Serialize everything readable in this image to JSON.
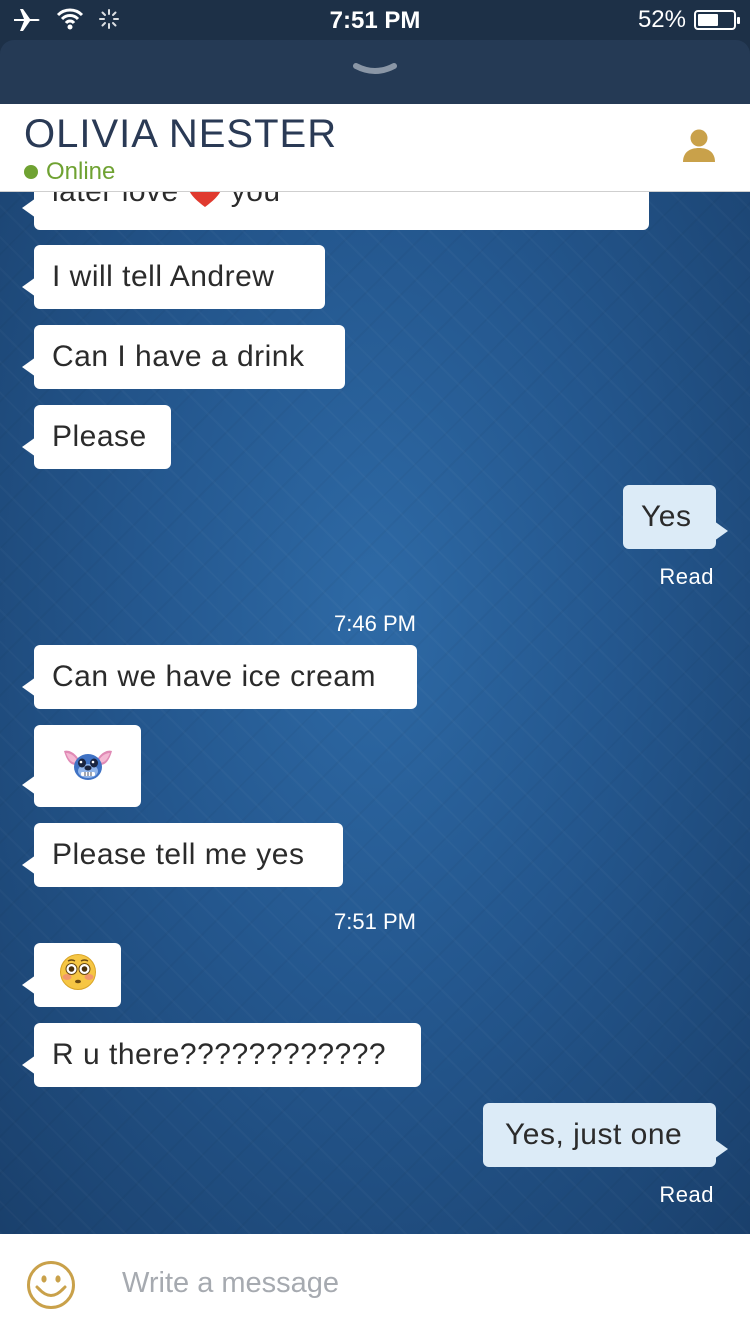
{
  "status_bar": {
    "time": "7:51 PM",
    "battery_percent": "52%",
    "battery_level": 0.52,
    "icons": [
      "airplane-icon",
      "wifi-icon",
      "loading-icon"
    ]
  },
  "header": {
    "contact_name": "OLIVIA NESTER",
    "presence": "Online",
    "presence_color": "#6fa232",
    "profile_icon_color": "#c9a14a"
  },
  "messages": {
    "m0_before": "later love",
    "m0_after": "you",
    "m1": "I will tell Andrew",
    "m2": "Can I have a drink",
    "m3": "Please",
    "m4": "Yes",
    "m4_status": "Read",
    "time_1": "7:46 PM",
    "m5": "Can we have ice cream",
    "m7": "Please tell me yes",
    "time_2": "7:51 PM",
    "m9": "R u there????????????",
    "m10": "Yes, just one",
    "m10_status": "Read"
  },
  "composer": {
    "placeholder": "Write a message"
  },
  "colors": {
    "incoming_bubble": "#ffffff",
    "outgoing_bubble": "#dcebf7",
    "chat_background": "#24578e",
    "header_text": "#2a3a55"
  }
}
